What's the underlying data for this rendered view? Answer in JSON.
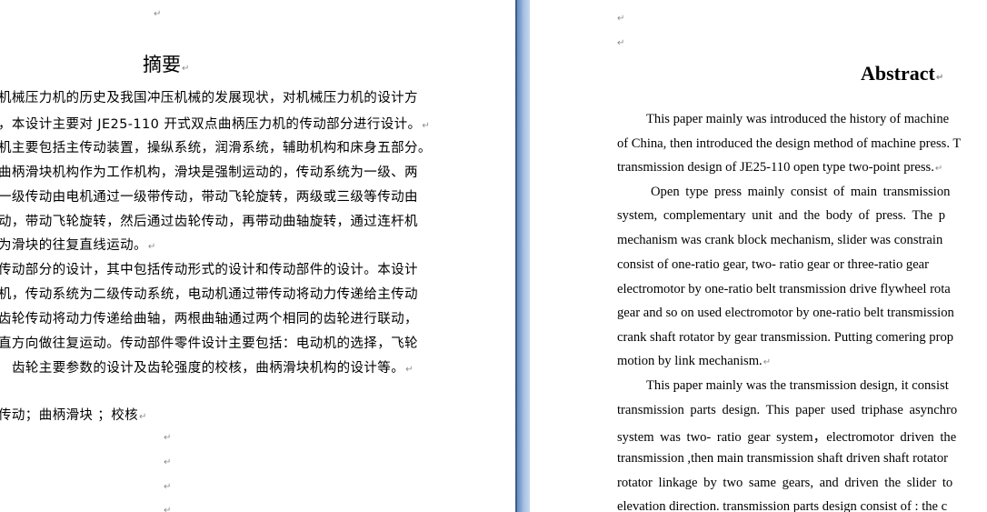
{
  "left_page": {
    "title": "摘要",
    "paragraph_mark": "↵",
    "lines": [
      "机械压力机的历史及我国冲压机械的发展现状，对机械压力机的设计方",
      "，本设计主要对 JE25-110 开式双点曲柄压力机的传动部分进行设计。",
      "机主要包括主传动装置，操纵系统，润滑系统，辅助机构和床身五部分。",
      "曲柄滑块机构作为工作机构，滑块是强制运动的，传动系统为一级、两",
      "一级传动由电机通过一级带传动，带动飞轮旋转，两级或三级等传动由",
      "动，带动飞轮旋转，然后通过齿轮传动，再带动曲轴旋转，通过连杆机",
      "为滑块的往复直线运动。",
      "传动部分的设计，其中包括传动形式的设计和传动部件的设计。本设计",
      "机，传动系统为二级传动系统，电动机通过带传动将动力传递给主传动",
      "齿轮传动将动力传递给曲轴，两根曲轴通过两个相同的齿轮进行联动，",
      "直方向做往复运动。传动部件零件设计主要包括：电动机的选择，飞轮",
      "齿轮主要参数的设计及齿轮强度的校核，曲柄滑块机构的设计等。"
    ],
    "keywords": "传动；曲柄滑块 ；校核"
  },
  "right_page": {
    "title": "Abstract",
    "paragraph_mark": "↵",
    "lines": [
      "This paper mainly was introduced the history of machine",
      "of China, then introduced the design method of machine press. T",
      "transmission design of JE25-110 open type two-point press.",
      "Open type press mainly consist of main transmission",
      "system, complementary unit and the body of press. The p",
      "mechanism was crank block mechanism, slider was constrain",
      "consist of one-ratio gear, two- ratio gear or three-ratio gear",
      "electromotor by one-ratio belt transmission drive flywheel rota",
      "gear and so on used electromotor by one-ratio belt transmission",
      "crank shaft rotator by gear transmission. Putting comering prop",
      "motion by link mechanism.",
      "This paper mainly was the transmission design, it consist",
      "transmission parts design. This paper used triphase asynchro",
      "system was two- ratio gear system，electromotor driven the",
      "transmission ,then main transmission shaft driven shaft rotator",
      "rotator linkage by two same gears, and driven the slider to",
      "elevation direction. transmission parts design consist of : the c"
    ]
  },
  "colors": {
    "page_background": "#ffffff",
    "text": "#000000",
    "formatting_mark": "#8a8a8a",
    "gutter": "#7fa2cf"
  }
}
